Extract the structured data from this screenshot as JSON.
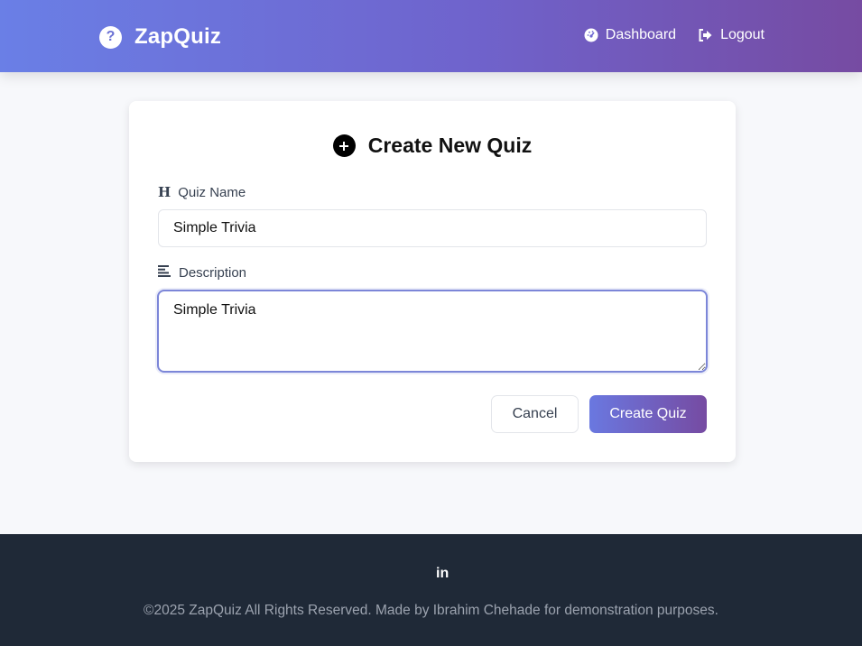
{
  "header": {
    "brand": "ZapQuiz",
    "brand_icon": "question-circle-icon",
    "nav": [
      {
        "label": "Dashboard",
        "icon": "gauge-icon"
      },
      {
        "label": "Logout",
        "icon": "logout-icon"
      }
    ]
  },
  "form": {
    "title": "Create New Quiz",
    "title_icon": "plus-circle-icon",
    "quiz_name_label": "Quiz Name",
    "quiz_name_icon": "heading-icon",
    "quiz_name_value": "Simple Trivia",
    "description_label": "Description",
    "description_icon": "align-left-icon",
    "description_value": "Simple Trivia",
    "cancel_label": "Cancel",
    "create_label": "Create Quiz"
  },
  "footer": {
    "social": "in",
    "social_icon": "linkedin-icon",
    "copyright": "©2025 ZapQuiz All Rights Reserved. Made by Ibrahim Chehade for demonstration purposes."
  },
  "colors": {
    "header_gradient_start": "#6a7fe6",
    "header_gradient_end": "#764ba2",
    "footer_bg": "#1f2937",
    "focus_border": "#7c86d8"
  }
}
